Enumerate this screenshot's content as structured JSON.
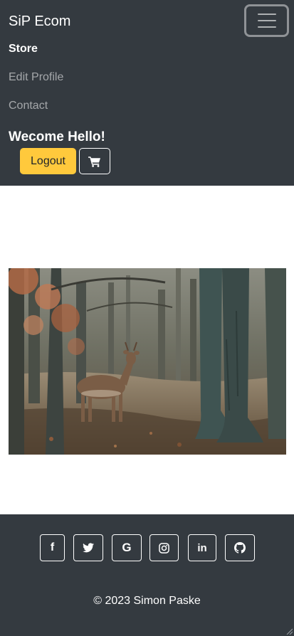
{
  "navbar": {
    "brand": "SiP Ecom",
    "links": [
      {
        "label": "Store",
        "active": true
      },
      {
        "label": "Edit Profile",
        "active": false
      },
      {
        "label": "Contact",
        "active": false
      }
    ],
    "welcome": "Wecome Hello!",
    "logout_label": "Logout",
    "toggler_icon": "hamburger-icon",
    "cart_icon": "shopping-cart-icon"
  },
  "hero": {
    "image_desc": "deer-in-forest",
    "colors": {
      "foliage": "#b26a47",
      "trunk": "#3f5452",
      "ground": "#8a7a63"
    }
  },
  "footer": {
    "socials": [
      {
        "name": "facebook-icon",
        "glyph": "f"
      },
      {
        "name": "twitter-icon",
        "glyph": ""
      },
      {
        "name": "google-icon",
        "glyph": "G"
      },
      {
        "name": "instagram-icon",
        "glyph": ""
      },
      {
        "name": "linkedin-icon",
        "glyph": "in"
      },
      {
        "name": "github-icon",
        "glyph": ""
      }
    ],
    "copyright": "© 2023 Simon Paske"
  },
  "colors": {
    "navbar_bg": "#343a40",
    "logout_bg": "#ffc93c",
    "text_light": "#ffffff"
  }
}
